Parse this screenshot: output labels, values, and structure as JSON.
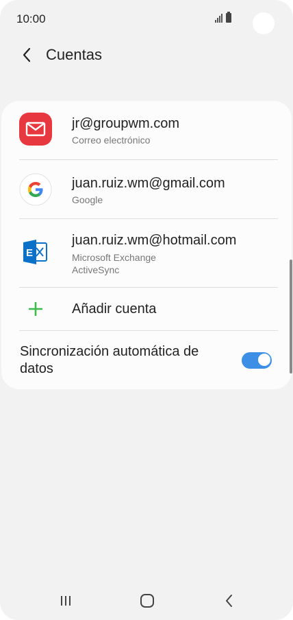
{
  "status_bar": {
    "time": "10:00"
  },
  "header": {
    "title": "Cuentas",
    "back_icon": "chevron-left-icon"
  },
  "accounts": [
    {
      "name": "jr@groupwm.com",
      "type": "Correo electrónico",
      "icon": "email-app-icon",
      "color": "#e8383f"
    },
    {
      "name": "juan.ruiz.wm@gmail.com",
      "type": "Google",
      "icon": "google-icon"
    },
    {
      "name": "juan.ruiz.wm@hotmail.com",
      "type": "Microsoft Exchange ActiveSync",
      "icon": "exchange-icon",
      "color": "#0b70c7"
    }
  ],
  "add_account": {
    "label": "Añadir cuenta",
    "icon": "plus-icon",
    "color": "#3dbb4d"
  },
  "auto_sync": {
    "label": "Sincronización automática de datos",
    "enabled": true,
    "color": "#3d8fe6"
  },
  "nav_bar": {
    "recents_icon": "recents-icon",
    "home_icon": "home-icon",
    "back_icon": "back-icon"
  }
}
